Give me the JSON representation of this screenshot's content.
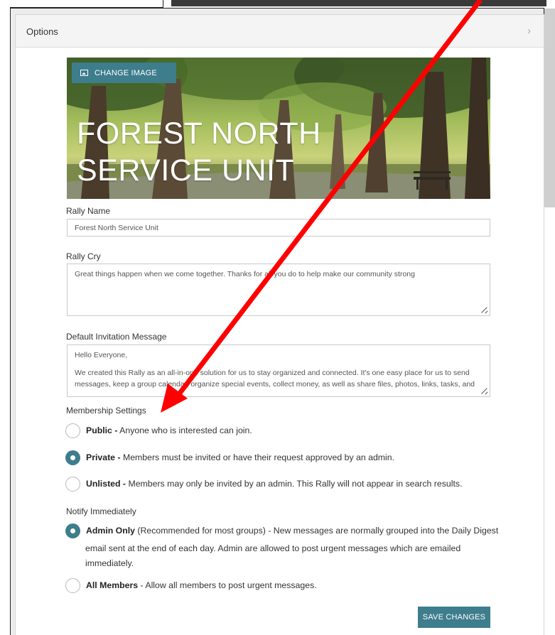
{
  "options": {
    "title": "Options",
    "chevron": "›"
  },
  "banner": {
    "change_image_label": "CHANGE IMAGE",
    "title_line1": "FOREST NORTH",
    "title_line2": "SERVICE UNIT"
  },
  "rally_name": {
    "label": "Rally Name",
    "value": "Forest North Service Unit"
  },
  "rally_cry": {
    "label": "Rally Cry",
    "value": "Great things happen when we come together. Thanks for all you do to help make our community strong"
  },
  "invitation": {
    "label": "Default Invitation Message",
    "line1": "Hello Everyone,",
    "line2": "We created this Rally as an all-in-one solution for us to stay organized and connected. It's one easy place for us to send",
    "line3": "messages, keep a group calendar, organize special events, collect money, as well as share files, photos, links, tasks, and"
  },
  "membership": {
    "label": "Membership Settings",
    "options": [
      {
        "title": "Public -",
        "desc": " Anyone who is interested can join.",
        "checked": false
      },
      {
        "title": "Private -",
        "desc": " Members must be invited or have their request approved by an admin.",
        "checked": true
      },
      {
        "title": "Unlisted -",
        "desc": " Members may only be invited by an admin. This Rally will not appear in search results.",
        "checked": false
      }
    ]
  },
  "notify": {
    "label": "Notify Immediately",
    "admin_only": {
      "title": "Admin Only",
      "desc_line1": " (Recommended for most groups) - New messages are normally grouped into the Daily Digest",
      "desc_line2": "email sent at the end of each day. Admin are allowed to post urgent messages which are emailed",
      "desc_line3": "immediately.",
      "checked": true
    },
    "all_members": {
      "title": "All Members",
      "desc": " - Allow all members to post urgent messages.",
      "checked": false
    }
  },
  "save_label": "SAVE CHANGES",
  "colors": {
    "accent": "#3d7d8c",
    "annotation_arrow": "#ff0000"
  }
}
